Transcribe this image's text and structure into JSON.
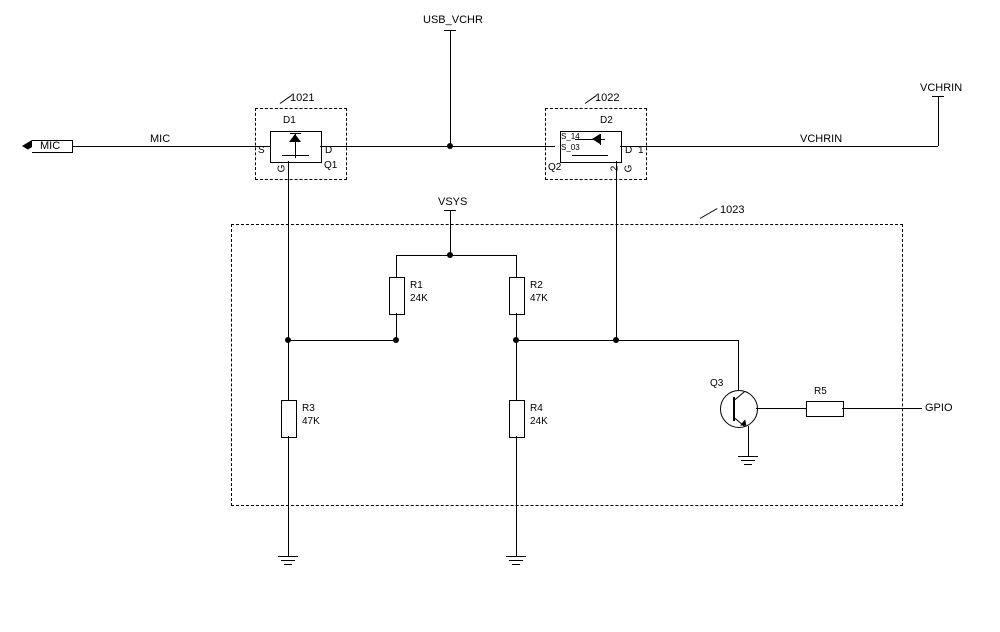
{
  "nets": {
    "usb_vchr": "USB_VCHR",
    "vchrin_top": "VCHRIN",
    "mic_port": "MIC",
    "mic_wire": "MIC",
    "vchrin_wire": "VCHRIN",
    "vsys": "VSYS",
    "gpio": "GPIO"
  },
  "blocks": {
    "b1021": "1021",
    "b1022": "1022",
    "b1023": "1023"
  },
  "components": {
    "d1": "D1",
    "q1": "Q1",
    "q1_s": "S",
    "q1_d": "D",
    "q1_g": "G",
    "d2": "D2",
    "q2": "Q2",
    "q2_s14": "S_14",
    "q2_s03": "S_03",
    "q2_d": "D",
    "q2_d1": "1",
    "q2_2": "2",
    "q2_g": "G",
    "q3": "Q3",
    "r1_name": "R1",
    "r1_val": "24K",
    "r2_name": "R2",
    "r2_val": "47K",
    "r3_name": "R3",
    "r3_val": "47K",
    "r4_name": "R4",
    "r4_val": "24K",
    "r5_name": "R5"
  }
}
